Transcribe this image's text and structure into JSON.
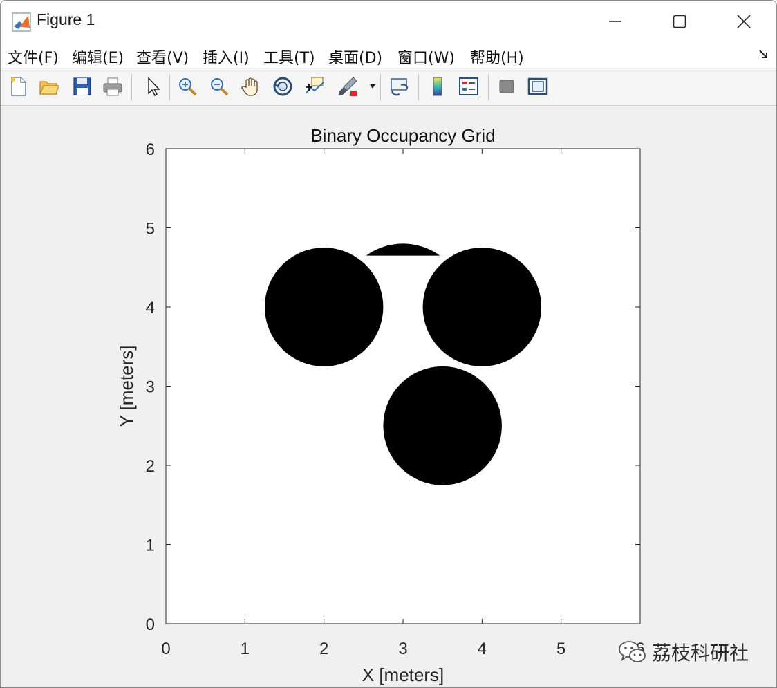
{
  "window": {
    "title": "Figure 1"
  },
  "menu": {
    "items": [
      "文件(F)",
      "编辑(E)",
      "查看(V)",
      "插入(I)",
      "工具(T)",
      "桌面(D)",
      "窗口(W)",
      "帮助(H)"
    ]
  },
  "toolbar": {
    "buttons": [
      "new-figure-icon",
      "open-file-icon",
      "save-icon",
      "print-icon",
      "pointer-icon",
      "zoom-in-icon",
      "zoom-out-icon",
      "pan-hand-icon",
      "rotate-3d-icon",
      "data-cursor-icon",
      "brush-icon",
      "link-plot-icon",
      "colorbar-icon",
      "legend-icon",
      "hide-plot-tools-icon",
      "show-plot-tools-icon"
    ]
  },
  "chart_data": {
    "type": "heatmap",
    "title": "Binary Occupancy Grid",
    "xlabel": "X [meters]",
    "ylabel": "Y [meters]",
    "xlim": [
      0,
      6
    ],
    "ylim": [
      0,
      6
    ],
    "xticks": [
      "0",
      "1",
      "2",
      "3",
      "4",
      "5",
      "6"
    ],
    "yticks": [
      "0",
      "1",
      "2",
      "3",
      "4",
      "5",
      "6"
    ],
    "grid": false,
    "obstacles": [
      {
        "shape": "circle",
        "center": [
          2.0,
          4.0
        ],
        "radius": 0.75
      },
      {
        "shape": "circle",
        "center": [
          4.0,
          4.0
        ],
        "radius": 0.75
      },
      {
        "shape": "circle",
        "center": [
          3.5,
          2.5
        ],
        "radius": 0.75
      },
      {
        "shape": "circle-cap",
        "center": [
          3.0,
          4.0
        ],
        "radius": 0.8,
        "visible_y_from": 4.65
      }
    ],
    "colors": {
      "occupied": "#000000",
      "free": "#ffffff"
    }
  },
  "watermark": {
    "text": "荔枝科研社"
  }
}
